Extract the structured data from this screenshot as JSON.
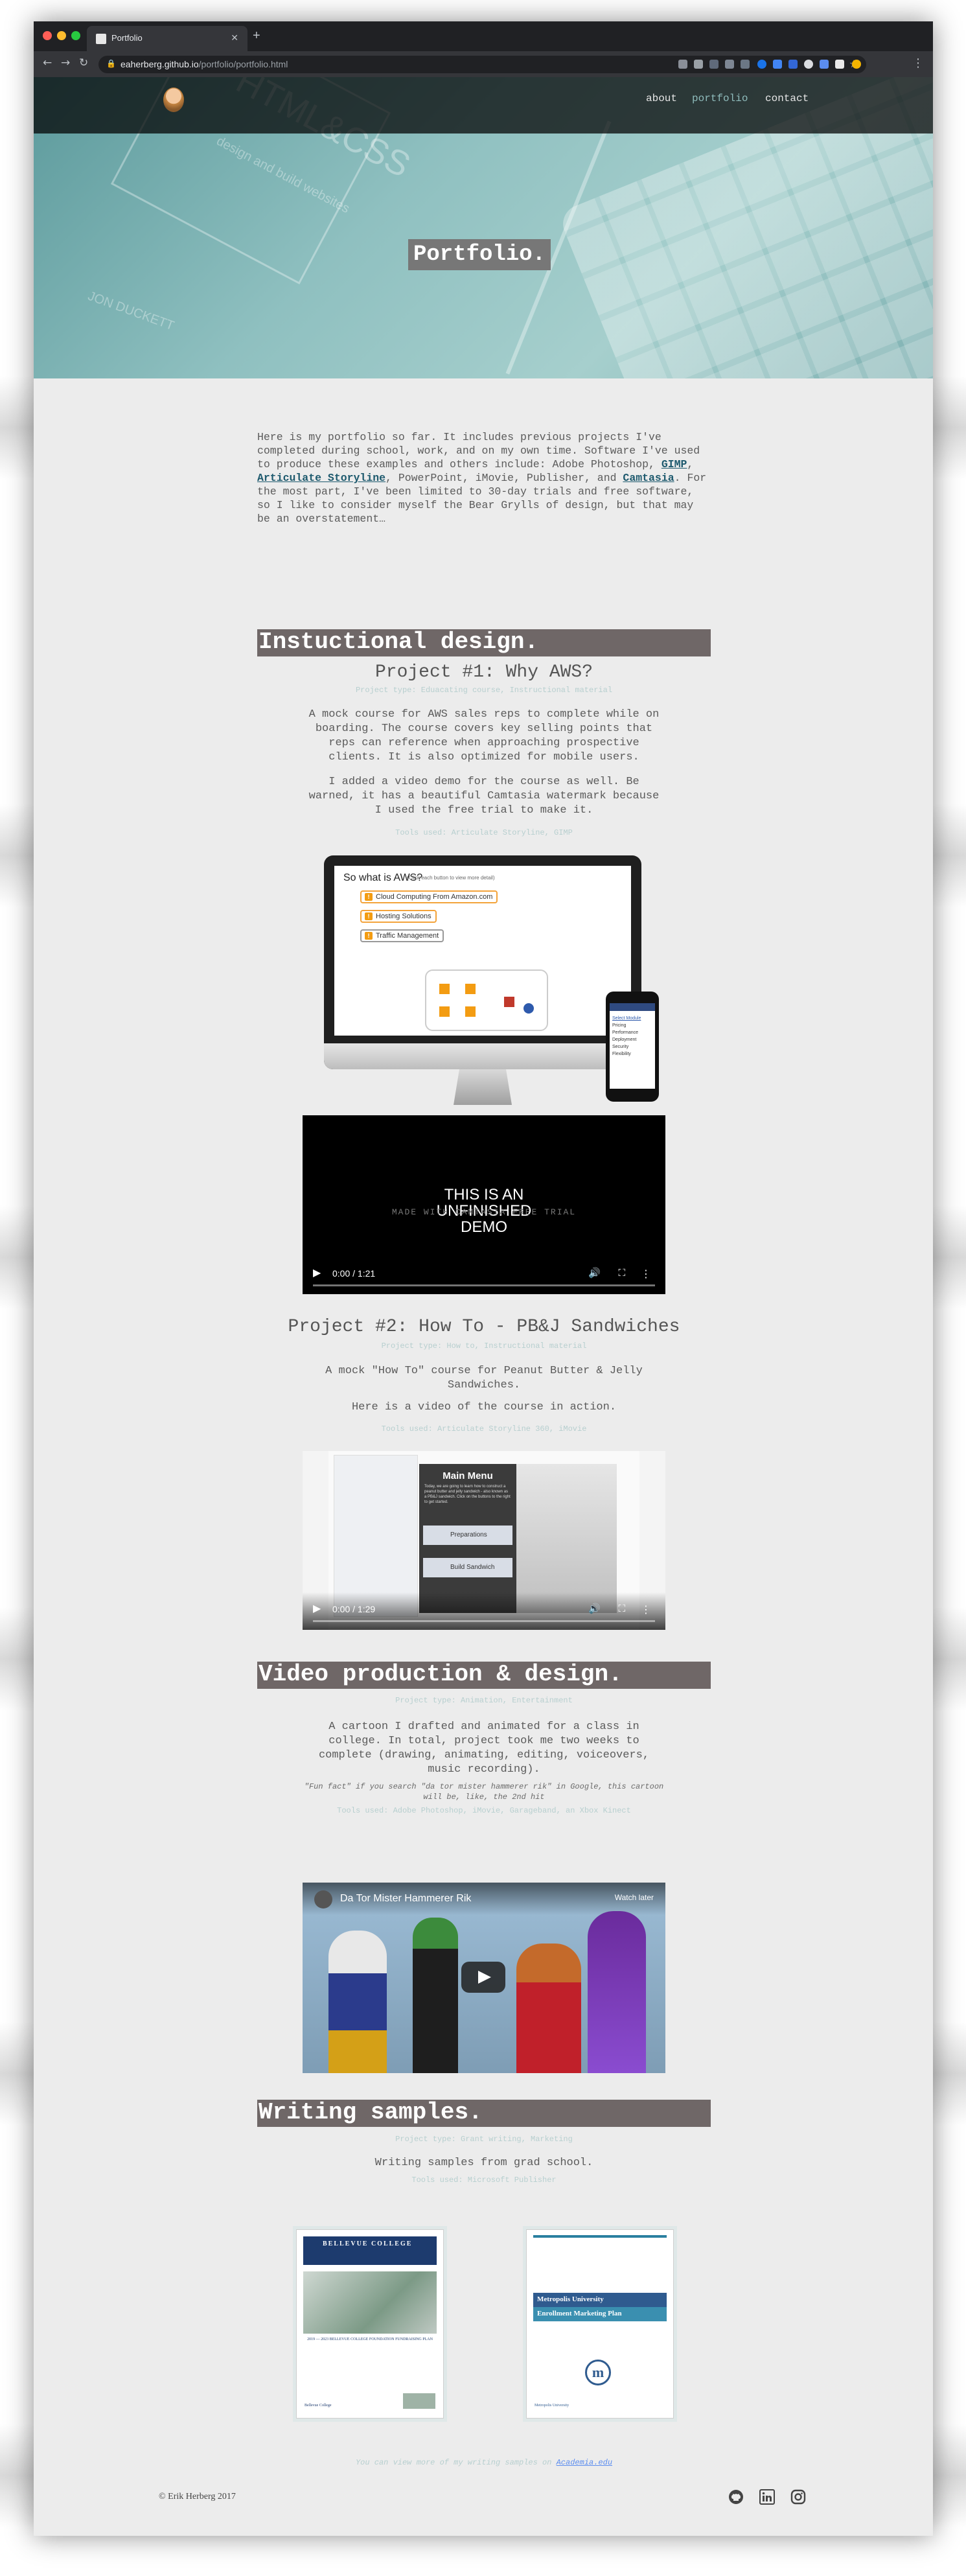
{
  "browser": {
    "tab_title": "Portfolio",
    "url_host": "eaherberg.github.io",
    "url_path": "/portfolio/portfolio.html"
  },
  "site_nav": {
    "links": [
      "about",
      "portfolio",
      "contact"
    ],
    "active": "portfolio",
    "active_color": "#8fbcbc"
  },
  "hero": {
    "title": "Portfolio.",
    "background_text": [
      "HTML&CSS",
      "design and build websites",
      "JON DUCKETT"
    ]
  },
  "intro": {
    "text_1": "Here is my portfolio so far. It includes previous projects I've completed during school, work, and on my own time. Software I've used to produce these examples and others include: Adobe Photoshop, ",
    "link_1": "GIMP",
    "text_2": ", ",
    "link_2": "Articulate Storyline",
    "text_3": ", PowerPoint, iMovie, Publisher, and ",
    "link_3": "Camtasia",
    "text_4": ". For the most part, I've been limited to 30-day trials and free software, so I like to consider myself the Bear Grylls of design, but that may be an overstatement…"
  },
  "instructional": {
    "heading": "Instuctional design.",
    "project1": {
      "title": "Project #1: Why AWS?",
      "type": "Project type: Eduacating course, Instructional material",
      "para1": "A mock course for AWS sales reps to complete while on boarding. The course covers key selling points that reps can reference when approaching prospective clients. It is also optimized for mobile users.",
      "para2": "I added a video demo for the course as well. Be warned, it has a beautiful Camtasia watermark because I used the free trial to make it.",
      "tools": "Tools used: Articulate Storyline, GIMP",
      "mock_slide_title": "So what is AWS?",
      "mock_slide_sub": "(Click each button to view more detail)",
      "mock_options": [
        "Cloud Computing From Amazon.com",
        "Hosting Solutions",
        "Traffic Management"
      ],
      "phone_menu": [
        "Select Module",
        "Pricing",
        "Performance",
        "Deployment",
        "Security",
        "Flexibility"
      ],
      "video_overlay": [
        "THIS IS AN",
        "UNFINISHED",
        "DEMO"
      ],
      "video_watermark": "MADE WITH CAMTASIA FREE TRIAL",
      "video_time": "0:00 / 1:21"
    },
    "project2": {
      "title": "Project #2: How To - PB&J Sandwiches",
      "type": "Project type: How to, Instructional material",
      "para1": "A mock \"How To\" course for Peanut Butter & Jelly Sandwiches.",
      "para2": "Here is a video of the course in action.",
      "tools": "Tools used: Articulate Storyline 360, iMovie",
      "menu_title": "Main Menu",
      "menu_text": "Today, we are going to learn how to construct a peanut butter and jelly sandwich - also known as a PB&J sandwich. Click on the buttons to the right to get started.",
      "menu_buttons": [
        "Preparations",
        "Build Sandwich"
      ],
      "video_time": "0:00 / 1:29"
    }
  },
  "video_production": {
    "heading": "Video production & design.",
    "type": "Project type: Animation, Entertainment",
    "para": "A cartoon I drafted and animated for a class in college. In total, project took me two weeks to complete (drawing, animating, editing, voiceovers, music recording).",
    "note": "\"Fun fact\" if you search \"da tor mister hammerer rik\" in Google, this cartoon will be, like, the 2nd hit",
    "tools": "Tools used: Adobe Photoshop, iMovie, Garageband, an Xbox Kinect",
    "youtube_title": "Da Tor Mister Hammerer Rik",
    "youtube_watch_later": "Watch later"
  },
  "writing": {
    "heading": "Writing samples.",
    "type": "Project type: Grant writing, Marketing",
    "para": "Writing samples from grad school.",
    "tools": "Tools used: Microsoft Publisher",
    "doc1": {
      "header": "BELLEVUE COLLEGE",
      "caption": "2019 — 2023 BELLEVUE COLLEGE FOUNDATION FUNDRAISING PLAN",
      "footer": "Bellevue College"
    },
    "doc2": {
      "title_line1": "Metropolis University",
      "title_line2": "Enrollment Marketing Plan",
      "footer": "Metropolis University"
    },
    "more_text": "You can view more of my writing samples on",
    "more_link": "Academia.edu"
  },
  "footer": {
    "copyright": "© Erik Herberg 2017",
    "icons": [
      "github-icon",
      "linkedin-icon",
      "instagram-icon"
    ]
  },
  "colors": {
    "section_heading_bg": "#6f6767",
    "link": "#1e5a6e",
    "meta_text": "#b7cfcf",
    "hero_teal": "#8fc0c0"
  }
}
